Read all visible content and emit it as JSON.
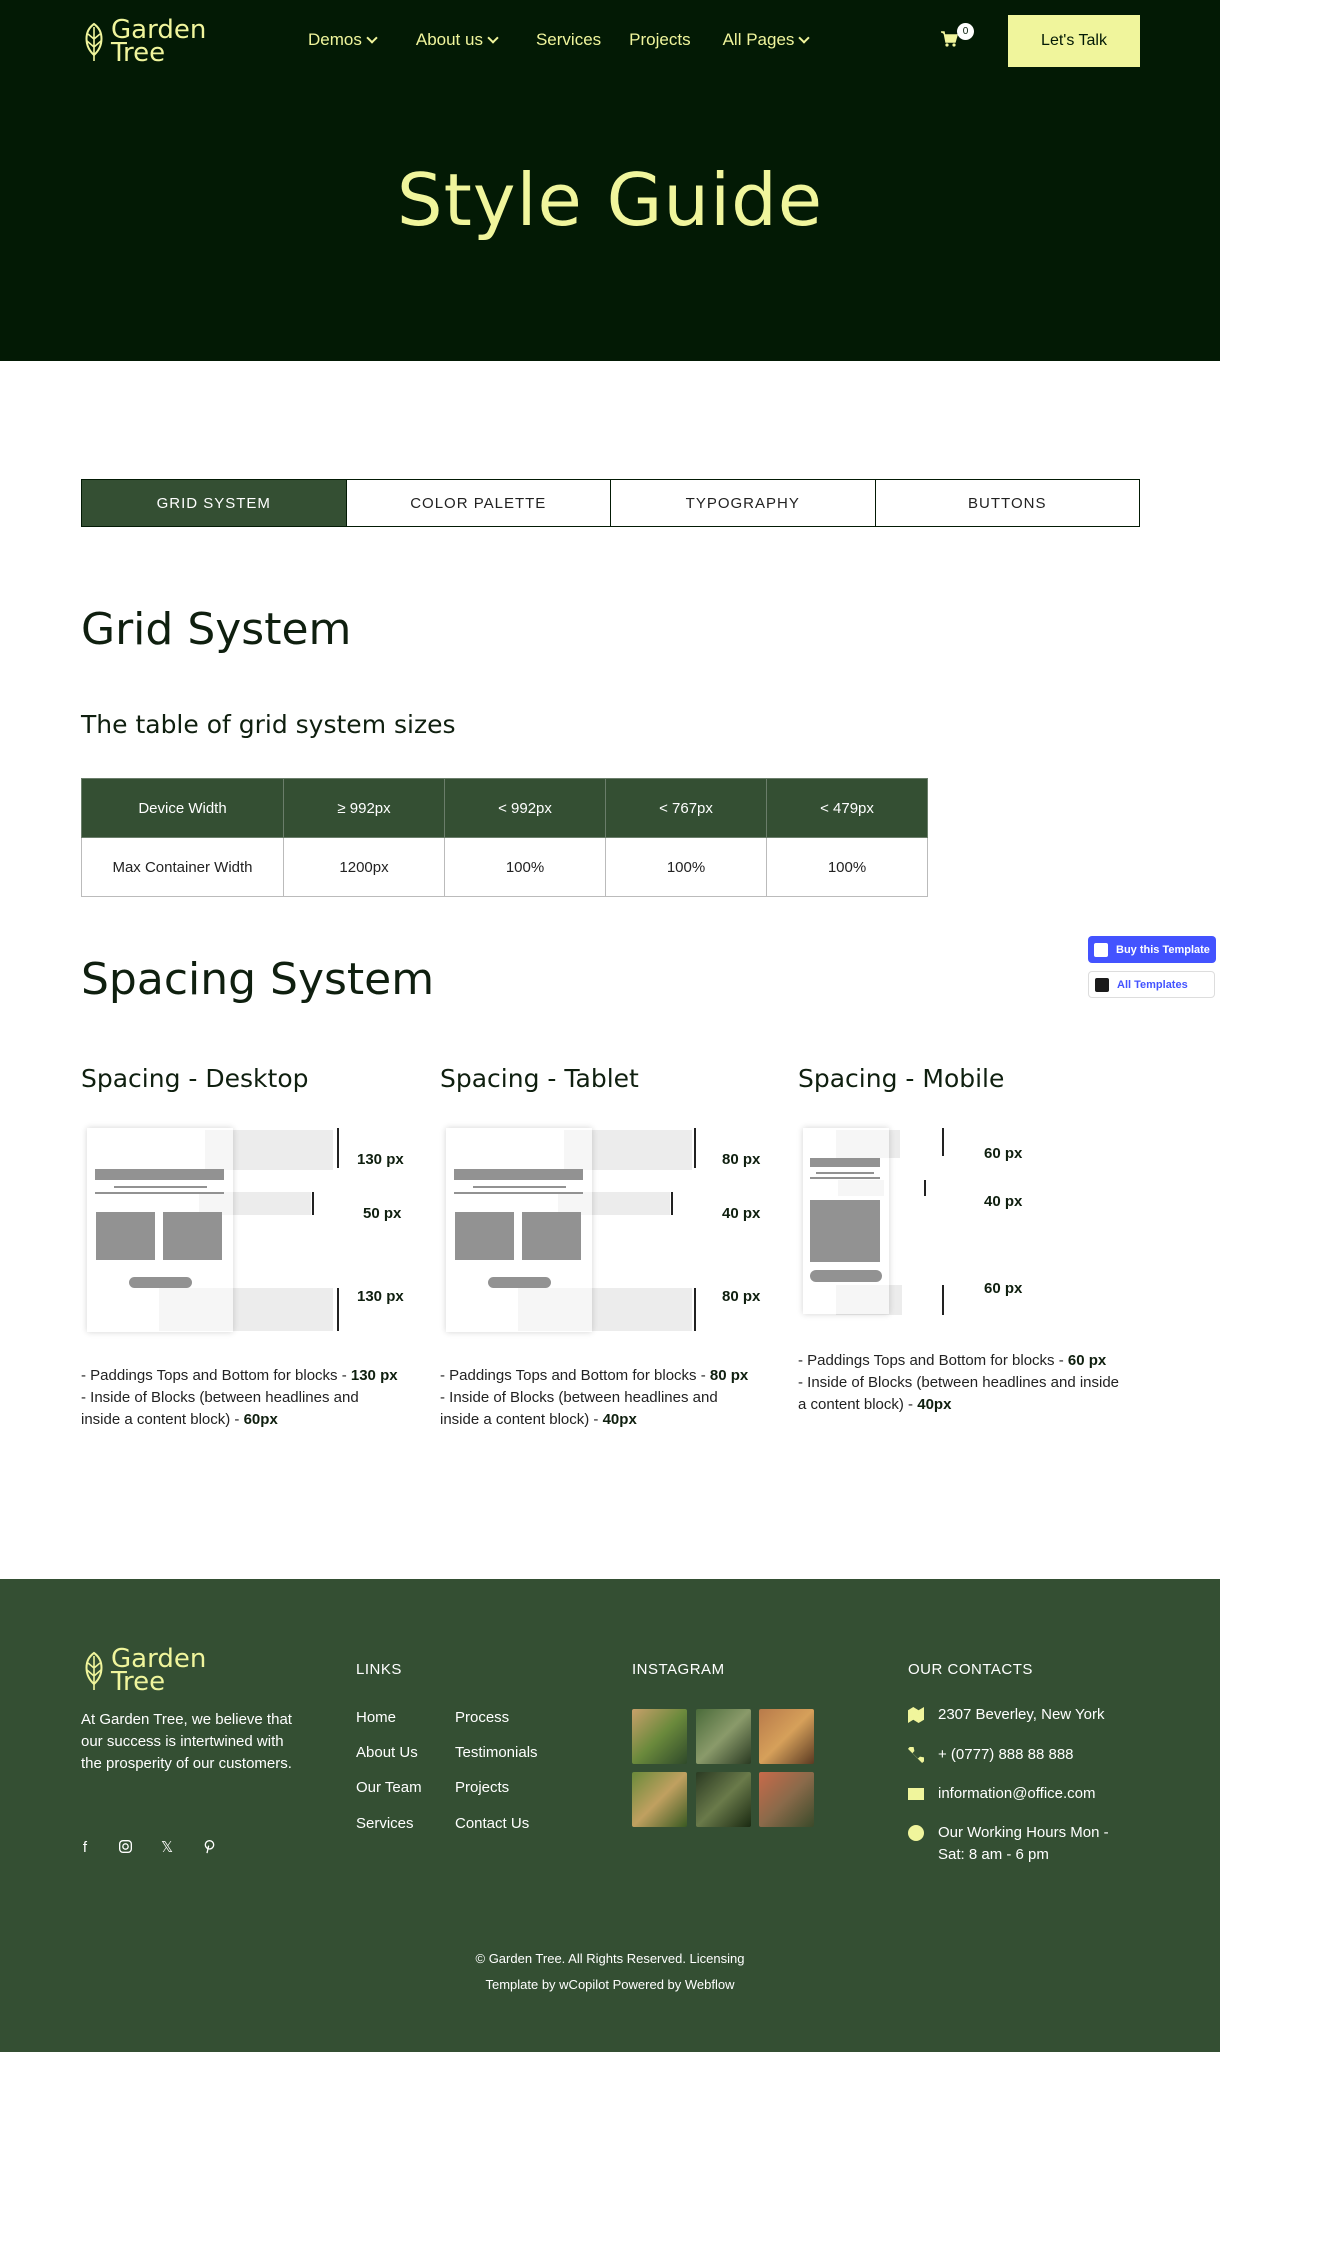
{
  "brand": {
    "line1": "Garden",
    "line2": "Tree"
  },
  "nav": {
    "items": [
      {
        "label": "Demos",
        "dropdown": true
      },
      {
        "label": "About us",
        "dropdown": true
      },
      {
        "label": "Services",
        "dropdown": false
      },
      {
        "label": "Projects",
        "dropdown": false
      },
      {
        "label": "All Pages",
        "dropdown": true
      }
    ],
    "cart_count": "0",
    "cta": "Let's Talk"
  },
  "hero": {
    "title": "Style Guide"
  },
  "tabs": [
    {
      "label": "GRID SYSTEM",
      "active": true
    },
    {
      "label": "COLOR PALETTE",
      "active": false
    },
    {
      "label": "TYPOGRAPHY",
      "active": false
    },
    {
      "label": "BUTTONS",
      "active": false
    }
  ],
  "grid": {
    "title": "Grid System",
    "subtitle": "The table of grid system sizes",
    "headers": [
      "Device Width",
      "≥ 992px",
      "< 992px",
      "< 767px",
      "< 479px"
    ],
    "row": [
      "Max Container Width",
      "1200px",
      "100%",
      "100%",
      "100%"
    ]
  },
  "spacing": {
    "title": "Spacing System",
    "desktop": {
      "title": "Spacing - Desktop",
      "labels": [
        "130 px",
        "50 px",
        "130 px"
      ],
      "desc1": "- Paddings Tops and Bottom for blocks - ",
      "val1": "130 px",
      "desc2": "- Inside of Blocks (between headlines and inside a content block) - ",
      "val2": "60px"
    },
    "tablet": {
      "title": "Spacing - Tablet",
      "labels": [
        "80 px",
        "40 px",
        "80 px"
      ],
      "desc1": "- Paddings Tops and Bottom for blocks - ",
      "val1": "80 px",
      "desc2": "- Inside of Blocks (between headlines and inside a content block) - ",
      "val2": "40px"
    },
    "mobile": {
      "title": "Spacing - Mobile",
      "labels": [
        "60 px",
        "40 px",
        "60 px"
      ],
      "desc1": "- Paddings Tops and Bottom for blocks - ",
      "val1": "60 px",
      "desc2": "- Inside of Blocks (between headlines and inside a content block) - ",
      "val2": "40px"
    }
  },
  "widgets": {
    "buy": "Buy this Template",
    "all": "All Templates"
  },
  "footer": {
    "about": "At Garden Tree, we believe that our success is intertwined with the prosperity of our customers.",
    "links_title": "LINKS",
    "links_col1": [
      "Home",
      "About Us",
      "Our Team",
      "Services"
    ],
    "links_col2": [
      "Process",
      "Testimonials",
      "Projects",
      "Contact Us"
    ],
    "instagram_title": "INSTAGRAM",
    "contacts_title": "OUR CONTACTS",
    "contacts": [
      {
        "icon": "map-icon",
        "text": "2307 Beverley, New York"
      },
      {
        "icon": "phone-icon",
        "text": "+ (0777) 888 88 888"
      },
      {
        "icon": "mail-icon",
        "text": "information@office.com"
      },
      {
        "icon": "clock-icon",
        "text": "Our Working Hours Mon - Sat: 8 am - 6 pm"
      }
    ],
    "copyright_line1": "© Garden Tree. All Rights Reserved. Licensing",
    "copyright_line2": "Template by wCopilot Powered by Webflow"
  },
  "colors": {
    "dark": "#031a05",
    "accent": "#f0f59c",
    "green": "#344f33",
    "widget": "#4353ff"
  }
}
